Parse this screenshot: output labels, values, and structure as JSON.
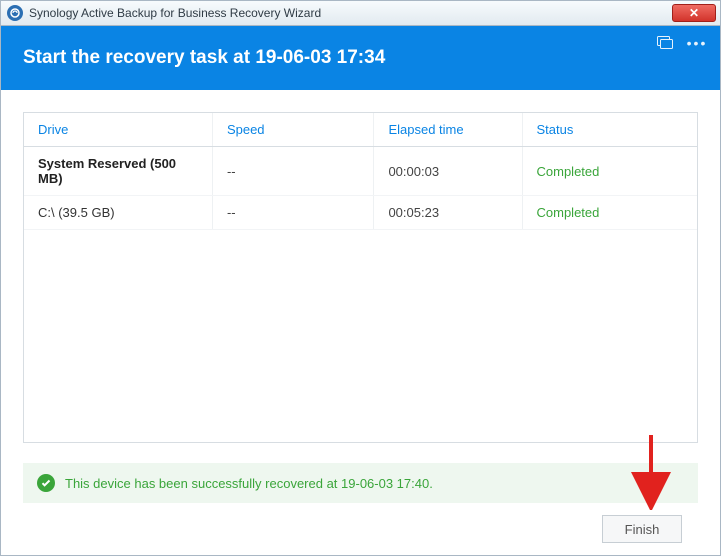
{
  "window": {
    "title": "Synology Active Backup for Business Recovery Wizard",
    "close_glyph": "✕"
  },
  "header": {
    "title": "Start the recovery task at 19-06-03 17:34",
    "more_glyph": "•••"
  },
  "table": {
    "columns": {
      "drive": "Drive",
      "speed": "Speed",
      "elapsed": "Elapsed time",
      "status": "Status"
    },
    "rows": [
      {
        "drive": "System Reserved (500 MB)",
        "speed": "--",
        "elapsed": "00:00:03",
        "status": "Completed",
        "bold": true
      },
      {
        "drive": "C:\\ (39.5 GB)",
        "speed": "--",
        "elapsed": "00:05:23",
        "status": "Completed",
        "bold": false
      }
    ]
  },
  "banner": {
    "message": "This device has been successfully recovered at 19-06-03 17:40."
  },
  "footer": {
    "finish_label": "Finish"
  },
  "colors": {
    "accent": "#0a84e4",
    "success": "#3aa53a"
  }
}
